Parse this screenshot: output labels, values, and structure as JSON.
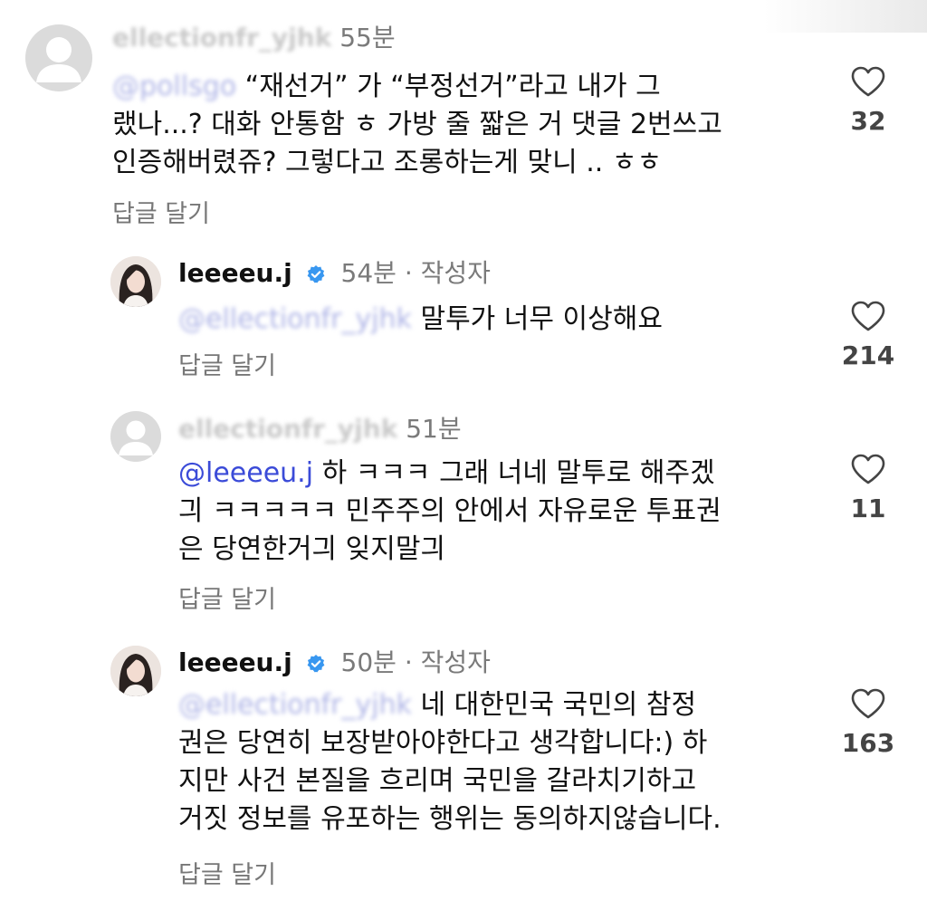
{
  "comments": [
    {
      "username": "ellectionfr_yjhk",
      "time": "55분",
      "mention": "@pollsgo",
      "lines": [
        "“재선거” 가 “부정선거”라고 내가 그",
        "랬나...? 대화 안통함 ㅎ 가방 줄 짧은 거 댓글 2번쓰고",
        "인증해버렸쥬? 그렇다고 조롱하는게 맞니 .. ㅎㅎ"
      ],
      "reply_label": "답글 달기",
      "likes": "32"
    },
    {
      "username": "leeeeu.j",
      "time": "54분",
      "dot": "·",
      "author_tag": "작성자",
      "mention": "@ellectionfr_yjhk",
      "lines": [
        "말투가 너무 이상해요"
      ],
      "reply_label": "답글 달기",
      "likes": "214"
    },
    {
      "username": "ellectionfr_yjhk",
      "time": "51분",
      "mention": "@leeeeu.j",
      "lines": [
        " 하 ㅋㅋㅋ 그래 너네 말투로 해주겠",
        "긔 ㅋㅋㅋㅋㅋ 민주주의 안에서 자유로운 투표권",
        "은 당연한거긔 잊지말긔"
      ],
      "reply_label": "답글 달기",
      "likes": "11"
    },
    {
      "username": "leeeeu.j",
      "time": "50분",
      "dot": "·",
      "author_tag": "작성자",
      "mention": "@ellectionfr_yjhk",
      "lines": [
        "네 대한민국 국민의 참정",
        "권은 당연히 보장받아야한다고 생각합니다:) 하",
        "지만 사건 본질을 흐리며 국민을 갈라치기하고",
        "거짓 정보를 유포하는 행위는 동의하지않습니다."
      ],
      "reply_label": "답글 달기",
      "likes": "163"
    }
  ],
  "colors": {
    "mention": "#3b4bd8",
    "verified": "#3897f0",
    "meta": "#7a7a7a"
  },
  "icons": {
    "like": "heart-outline-icon",
    "verified": "verified-badge-icon",
    "avatar_default": "default-avatar-icon"
  }
}
